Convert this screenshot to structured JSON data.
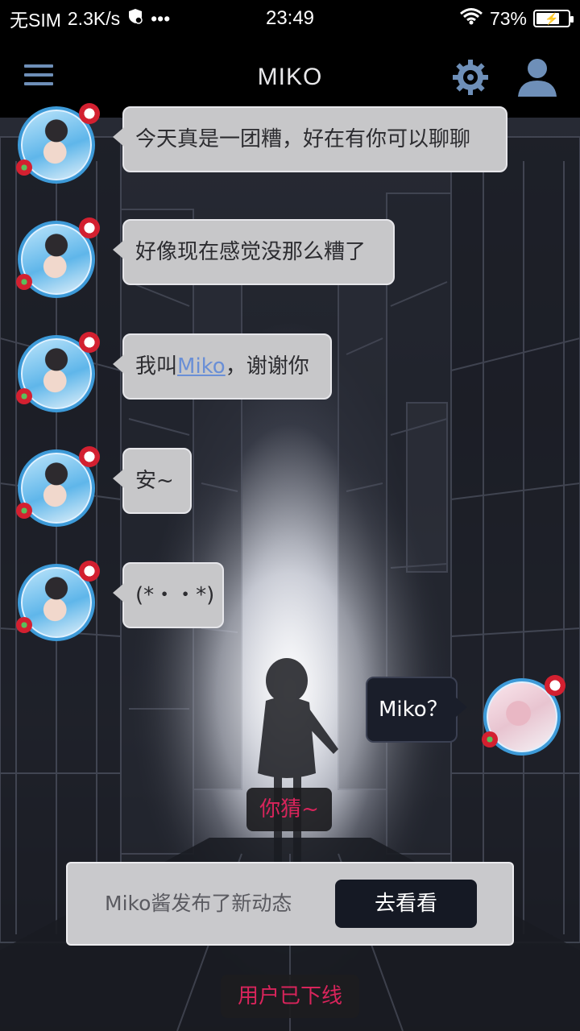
{
  "status_bar": {
    "carrier": "无SIM",
    "speed": "2.3K/s",
    "more": "•••",
    "time": "23:49",
    "battery": "73%",
    "battery_level": 0.73
  },
  "app_bar": {
    "title": "MIKO",
    "icons": [
      "menu-icon",
      "gear-icon",
      "user-icon"
    ]
  },
  "messages": [
    {
      "side": "left",
      "text": "今天真是一团糟，好在有你可以聊聊"
    },
    {
      "side": "left",
      "text": "好像现在感觉没那么糟了"
    },
    {
      "side": "left",
      "before": "我叫",
      "link": "Miko",
      "after": "，谢谢你"
    },
    {
      "side": "left",
      "text": "安~"
    },
    {
      "side": "left",
      "text": "(*・・*)"
    },
    {
      "side": "right",
      "text": "Miko？"
    }
  ],
  "reply_hint": "你猜~",
  "notice": {
    "text": "Miko酱发布了新动态",
    "button": "去看看"
  },
  "offline_status": "用户已下线",
  "colors": {
    "accent_blue": "#6e8fb8",
    "offline_red": "#d8245b",
    "bubble_gray": "#c7c7c9",
    "bubble_dark": "#1a1e2a"
  }
}
